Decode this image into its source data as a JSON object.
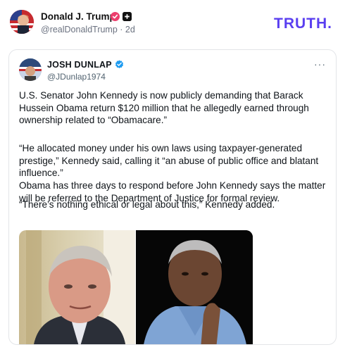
{
  "post": {
    "author_name": "Donald J. Trump",
    "author_handle": "@realDonaldTrump",
    "age": "2d",
    "brand": "TRUTH."
  },
  "quote": {
    "author_name": "JOSH DUNLAP",
    "author_handle": "@JDunlap1974",
    "more": "···",
    "paragraphs": [
      "U.S. Senator John Kennedy is now publicly demanding that Barack Hussein Obama return $120 million that he allegedly earned through ownership related to “Obamacare.”",
      "“He allocated money under his own laws using taxpayer-generated prestige,” Kennedy said, calling it “an abuse of public office and blatant influence.”",
      "Obama has three days to respond before John Kennedy says the matter will be referred to the Department of Justice for formal review.",
      "“There’s nothing ethical or legal about this,” Kennedy added."
    ]
  },
  "colors": {
    "brand": "#5a3ff0",
    "verified_pink": "#ec3f6d",
    "verified_blue": "#1d9bf0"
  },
  "icons": {
    "post_verified": "verified-badge-icon",
    "post_badge": "plus-badge-icon",
    "quote_verified": "verified-check-icon",
    "more": "more-options-icon"
  }
}
